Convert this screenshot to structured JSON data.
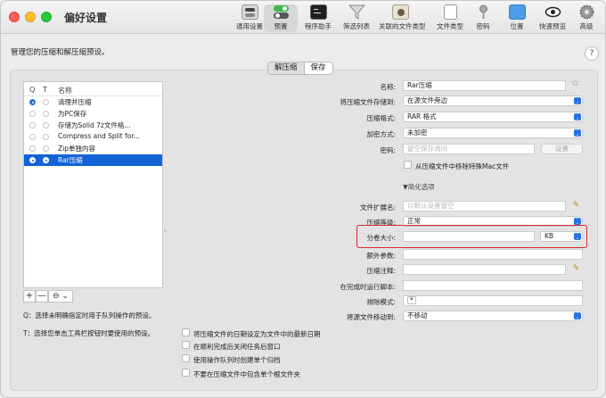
{
  "window": {
    "title": "偏好设置"
  },
  "toolbar": [
    {
      "label": "通用设置",
      "icon": "switch-icon"
    },
    {
      "label": "预置",
      "icon": "toggles-icon",
      "active": true
    },
    {
      "label": "程序助手",
      "icon": "terminal-icon"
    },
    {
      "label": "筛选列表",
      "icon": "funnel-icon"
    },
    {
      "label": "关联的文件类型",
      "icon": "app-icon"
    },
    {
      "label": "文件类型",
      "icon": "document-icon"
    },
    {
      "label": "密码",
      "icon": "key-icon"
    },
    {
      "label": "位置",
      "icon": "folder-icon"
    },
    {
      "label": "快速预览",
      "icon": "eye-icon"
    },
    {
      "label": "高级",
      "icon": "gear-icon"
    }
  ],
  "hint": "管理您的压缩和解压缩预设。",
  "help": "?",
  "tabs": {
    "compress": "解压缩",
    "save": "保存"
  },
  "list": {
    "headers": {
      "q": "Q",
      "t": "T",
      "name": "名称"
    },
    "rows": [
      {
        "name": "清理并压缩",
        "q": true,
        "t": false,
        "selected": false
      },
      {
        "name": "为PC保存",
        "q": false,
        "t": false,
        "selected": false
      },
      {
        "name": "存储为Solid 7z文件格...",
        "q": false,
        "t": false,
        "selected": false
      },
      {
        "name": "Compress and Split for...",
        "q": false,
        "t": false,
        "selected": false
      },
      {
        "name": "Zip单独内容",
        "q": false,
        "t": false,
        "selected": false
      },
      {
        "name": "Rar压缩",
        "q": true,
        "t": true,
        "selected": true
      }
    ],
    "buttons": {
      "add": "+",
      "remove": "—",
      "more": "⊖ ⌄"
    }
  },
  "notes": {
    "q": "Q：选择未明确指定时用于队列操作的预设。",
    "t": "T：选择您单击工具栏按钮时要使用的预设。"
  },
  "form": {
    "name_label": "名称:",
    "name_value": "Rar压缩",
    "store_label": "将压缩文件存储到:",
    "store_value": "在源文件旁边",
    "format_label": "压缩格式:",
    "format_value": "RAR 格式",
    "encrypt_label": "加密方式:",
    "encrypt_value": "未加密",
    "password_label": "密码:",
    "password_placeholder": "留空保存询问",
    "password_button": "设置",
    "strip_mac_label": "从压缩文件中移除特殊Mac文件",
    "simplify_label": "▼简化选项",
    "ext_label": "文件扩展名:",
    "ext_placeholder": "以默认设置留空",
    "level_label": "压缩等级:",
    "level_value": "正常",
    "split_label": "分卷大小:",
    "split_value": "",
    "split_unit": "KB",
    "extra_label": "额外参数:",
    "extra_value": "",
    "comment_label": "压缩注释:",
    "comment_value": "",
    "script_label": "在完成时运行脚本:",
    "script_value": "",
    "exclude_label": "排除模式:",
    "exclude_value": "*",
    "move_label": "将源文件移动到:",
    "move_value": "不移动"
  },
  "checks": [
    "将压缩文件的日期设定为文件中的最新日期",
    "在顺利完成后关闭任务后窗口",
    "使用操作队列时创建单个归档",
    "不要在压缩文件中包含单个根文件夹"
  ]
}
